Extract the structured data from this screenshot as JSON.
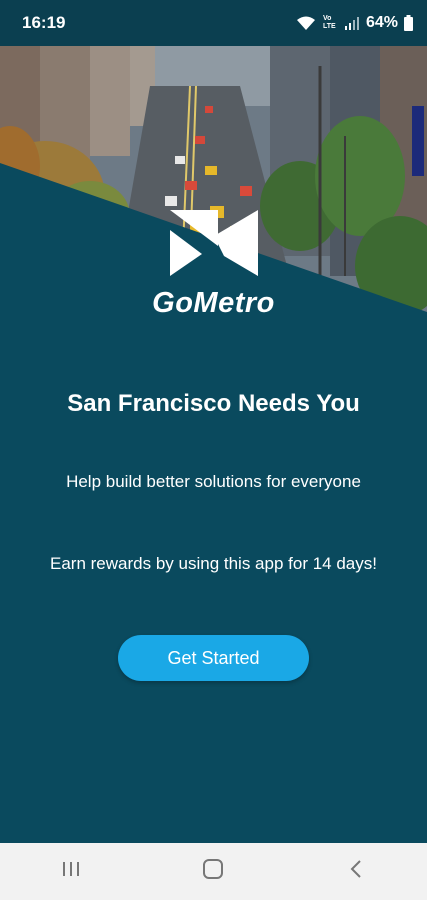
{
  "status_bar": {
    "time": "16:19",
    "network": "VoLTE",
    "battery": "64%"
  },
  "brand": {
    "name": "GoMetro",
    "colors": {
      "background": "#0a4a5e",
      "accent": "#1aa8e6",
      "text": "#ffffff"
    }
  },
  "main": {
    "headline": "San Francisco Needs You",
    "subline": "Help build better solutions for everyone",
    "rewards": "Earn rewards by using this app for 14 days!",
    "cta_label": "Get Started"
  },
  "nav_bar": {
    "buttons": [
      {
        "name": "recents-icon"
      },
      {
        "name": "home-icon"
      },
      {
        "name": "back-icon"
      }
    ]
  }
}
